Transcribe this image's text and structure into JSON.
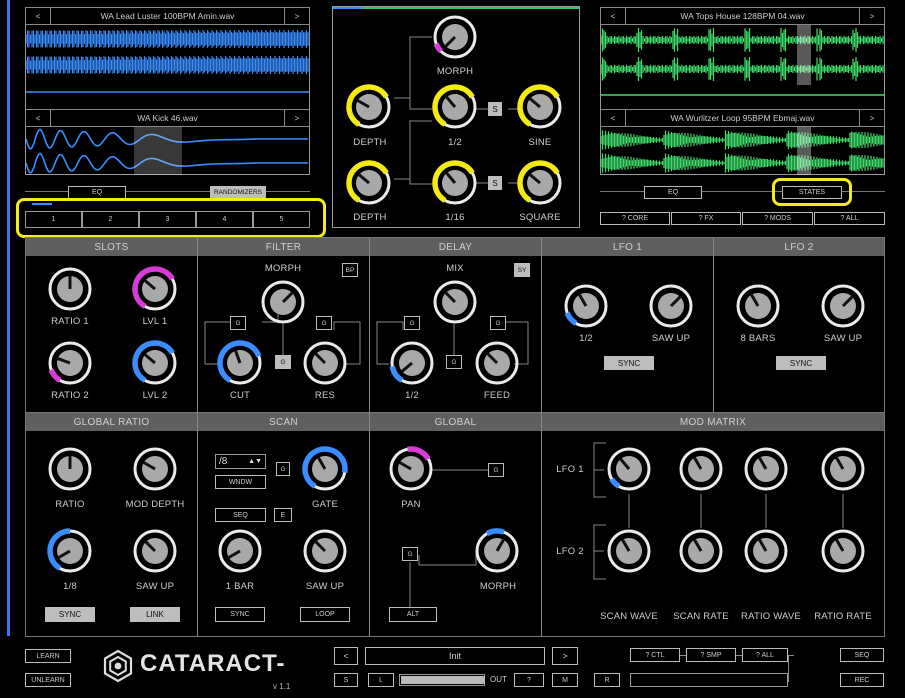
{
  "colors": {
    "accent_blue": "#3a8dff",
    "yellow": "#f3ea12",
    "magenta": "#d93bd9",
    "green": "#3fdc6c",
    "header_gray": "#5f5f5f"
  },
  "samples": {
    "left_top": {
      "name": "WA Lead Luster 100BPM Amin.wav",
      "prev": "<",
      "next": ">"
    },
    "left_bottom": {
      "name": "WA Kick 46.wav",
      "prev": "<",
      "next": ">"
    },
    "right_top": {
      "name": "WA Tops House 128BPM 04.wav",
      "prev": "<",
      "next": ">"
    },
    "right_bottom": {
      "name": "WA Wurlitzer Loop 95BPM Ebmaj.wav",
      "prev": "<",
      "next": ">"
    }
  },
  "left_controls": {
    "eq": "EQ",
    "randomizers": "RANDOMIZERS",
    "slots": [
      "1",
      "2",
      "3",
      "4",
      "5"
    ]
  },
  "right_controls": {
    "eq": "EQ",
    "states": "STATES",
    "core": "? CORE",
    "fx": "? FX",
    "mods": "? MODS",
    "all": "? ALL"
  },
  "morph": {
    "morph": "MORPH",
    "depth1": "DEPTH",
    "half": "1/2",
    "sine": "SINE",
    "depth2": "DEPTH",
    "sixteenth": "1/16",
    "square": "SQUARE",
    "s": "S"
  },
  "sections": {
    "slots": "SLOTS",
    "filter": "FILTER",
    "delay": "DELAY",
    "lfo1": "LFO 1",
    "lfo2": "LFO 2",
    "global_ratio": "GLOBAL RATIO",
    "scan": "SCAN",
    "global": "GLOBAL",
    "mod_matrix": "MOD MATRIX"
  },
  "slots": {
    "ratio1": "RATIO 1",
    "lvl1": "LVL 1",
    "ratio2": "RATIO 2",
    "lvl2": "LVL 2"
  },
  "filter": {
    "morph": "MORPH",
    "bp": "BP",
    "cut": "CUT",
    "res": "RES",
    "g": "G"
  },
  "delay": {
    "mix": "MIX",
    "sy": "SY",
    "half": "1/2",
    "feed": "FEED",
    "g": "G"
  },
  "lfo1": {
    "rate": "1/2",
    "shape": "SAW UP",
    "sync": "SYNC"
  },
  "lfo2": {
    "rate": "8 BARS",
    "shape": "SAW UP",
    "sync": "SYNC"
  },
  "global_ratio": {
    "ratio": "RATIO",
    "mod_depth": "MOD DEPTH",
    "rate": "1/8",
    "shape": "SAW UP",
    "sync": "SYNC",
    "link": "LINK"
  },
  "scan": {
    "select_value": "/8",
    "wndw": "WNDW",
    "seq": "SEQ",
    "e": "E",
    "g": "G",
    "gate": "GATE",
    "rate": "1 BAR",
    "shape": "SAW UP",
    "sync": "SYNC",
    "loop": "LOOP"
  },
  "global": {
    "pan": "PAN",
    "morph": "MORPH",
    "g": "G",
    "alt": "ALT"
  },
  "mod_matrix": {
    "lfo1": "LFO 1",
    "lfo2": "LFO 2",
    "scan_wave": "SCAN WAVE",
    "scan_rate": "SCAN RATE",
    "ratio_wave": "RATIO WAVE",
    "ratio_rate": "RATIO RATE"
  },
  "footer": {
    "learn": "LEARN",
    "unlearn": "UNLEARN",
    "brand": "CATARACT",
    "version": "v 1.1",
    "prev": "<",
    "preset": "Init",
    "next": ">",
    "s": "S",
    "l": "L",
    "out": "OUT",
    "q": "?",
    "m": "M",
    "r": "R",
    "ctl": "? CTL",
    "smp": "? SMP",
    "all": "? ALL",
    "seq": "SEQ",
    "rec": "REC"
  }
}
